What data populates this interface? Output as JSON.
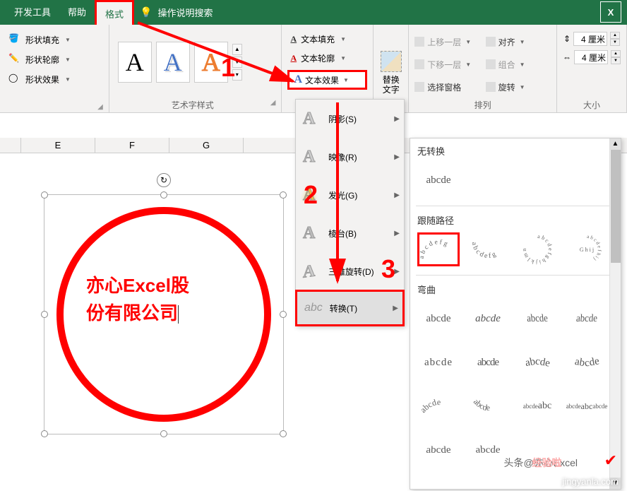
{
  "topbar": {
    "tabs": {
      "dev": "开发工具",
      "help": "帮助",
      "format": "格式"
    },
    "search": "操作说明搜索",
    "excel_badge": "X"
  },
  "ribbon": {
    "shape_styles": {
      "fill": "形状填充",
      "outline": "形状轮廓",
      "effects": "形状效果"
    },
    "wordart": {
      "label": "艺术字样式"
    },
    "text_opts": {
      "fill": "文本填充",
      "outline": "文本轮廓",
      "effects": "文本效果"
    },
    "alt_text": {
      "line1": "替换",
      "line2": "文字"
    },
    "arrange": {
      "bring_forward": "上移一层",
      "send_backward": "下移一层",
      "selection_pane": "选择窗格",
      "align": "对齐",
      "group": "组合",
      "rotate": "旋转",
      "label": "排列"
    },
    "size": {
      "height": "4 厘米",
      "width": "4 厘米",
      "label": "大小"
    }
  },
  "columns": {
    "e": "E",
    "f": "F",
    "g": "G"
  },
  "shape_text": {
    "line1": "亦心Excel股",
    "line2": "份有限公司"
  },
  "text_effect_menu": {
    "shadow": "阴影(S)",
    "reflection": "映像(R)",
    "glow": "发光(G)",
    "bevel": "棱台(B)",
    "rotation3d": "三维旋转(D)",
    "transform": "转换(T)"
  },
  "transform": {
    "no_transform": "无转换",
    "no_transform_sample": "abcde",
    "follow_path": "跟随路径",
    "warp": "弯曲",
    "sample": "abcde"
  },
  "annotations": {
    "one": "1",
    "two": "2",
    "three": "3"
  },
  "footer": {
    "toutiao": "头条@亦心Excel",
    "watermark": "jingyanla.com",
    "experience": "经验啦"
  }
}
